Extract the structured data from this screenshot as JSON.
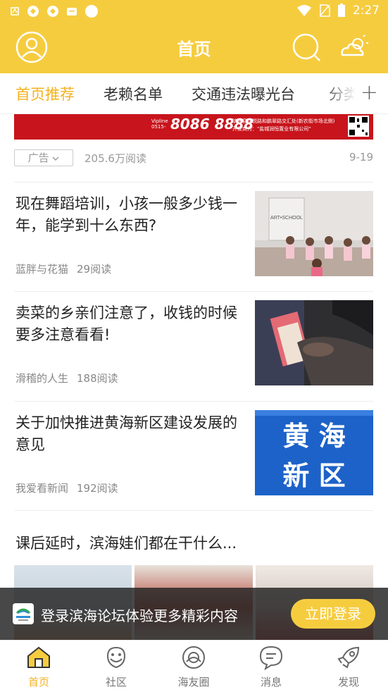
{
  "status_bar": {
    "time": "2:27",
    "left_icons": [
      "notification-icon",
      "app-icon",
      "app-icon",
      "message-icon",
      "circle-icon"
    ],
    "right_icons": [
      "wifi-icon",
      "no-sim-icon",
      "battery-icon"
    ]
  },
  "header": {
    "title": "首页",
    "left_icon": "user-icon",
    "right_icons": [
      "search-icon",
      "weather-icon"
    ],
    "bg_color": "#F6CC3F"
  },
  "tabs": {
    "items": [
      "首页推荐",
      "老赖名单",
      "交通违法曝光台",
      "分类"
    ],
    "active_index": 0,
    "add_label": "+",
    "active_color": "#F3B21F"
  },
  "ad": {
    "banner_phone": "8086 8888",
    "banner_prefix": "Vipline",
    "banner_area": "0515-",
    "banner_info_1": "滨海县淀悦路和鹏翠路交汇处(新农街市场北侧)",
    "banner_info_2": "开发商为：\"盐城润恒置业有限公司\"",
    "tag": "广告",
    "reads": "205.6万阅读",
    "date": "9-19"
  },
  "articles": [
    {
      "title": "现在舞蹈培训，小孩一般多少钱一年，能学到十么东西?",
      "author": "蓝胖与花猫",
      "reads": "29阅读",
      "thumb_sign": "ART•SCHOOL"
    },
    {
      "title": "卖菜的乡亲们注意了，收钱的时候要多注意看看!",
      "author": "滑稽的人生",
      "reads": "188阅读"
    },
    {
      "title": "关于加快推进黄海新区建设发展的意见",
      "author": "我爱看新闻",
      "reads": "192阅读",
      "thumb_line_1": "黄 海",
      "thumb_line_2": "新 区"
    }
  ],
  "gallery_article": {
    "title": "课后延时，滨海娃们都在干什么..."
  },
  "login_bar": {
    "text": "登录滨海论坛体验更多精彩内容",
    "button": "立即登录"
  },
  "bottom_nav": {
    "items": [
      {
        "label": "首页",
        "icon": "home-icon"
      },
      {
        "label": "社区",
        "icon": "community-icon"
      },
      {
        "label": "海友圈",
        "icon": "friends-circle-icon"
      },
      {
        "label": "消息",
        "icon": "message-icon"
      },
      {
        "label": "发现",
        "icon": "discover-icon"
      }
    ],
    "active_index": 0
  }
}
